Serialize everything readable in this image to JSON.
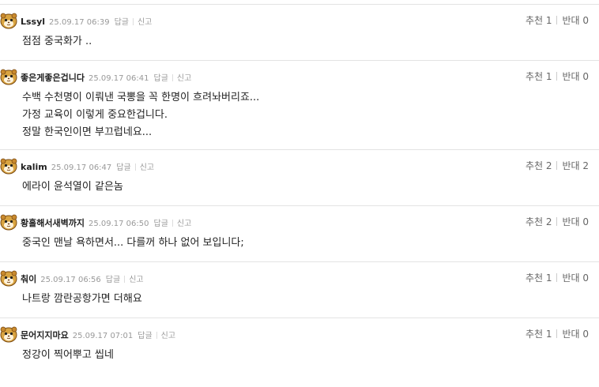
{
  "actions": {
    "reply": "답글",
    "report": "신고"
  },
  "comments": [
    {
      "nick": "Lssyl",
      "date": "25.09.17 06:39",
      "lines": [
        "점점 중국화가 .."
      ],
      "up_label": "추천 1",
      "down_label": "반대 0",
      "avatar_icon": "hamster-avatar-icon"
    },
    {
      "nick": "좋은게좋은겁니다",
      "date": "25.09.17 06:41",
      "lines": [
        "수백 수천명이 이뤄낸 국뽕을 꼭 한명이 흐려놔버리죠...",
        "가정 교육이 이렇게 중요한겁니다.",
        "정말 한국인이면 부끄럽네요..."
      ],
      "up_label": "추천 1",
      "down_label": "반대 0",
      "avatar_icon": "hamster-avatar-icon"
    },
    {
      "nick": "kalim",
      "date": "25.09.17 06:47",
      "lines": [
        "에라이 윤석열이 같은놈"
      ],
      "up_label": "추천 2",
      "down_label": "반대 2",
      "avatar_icon": "hamster-avatar-icon"
    },
    {
      "nick": "황홀해서새벽까지",
      "date": "25.09.17 06:50",
      "lines": [
        "중국인 맨날 욕하면서... 다를꺼 하나 없어 보입니다;"
      ],
      "up_label": "추천 2",
      "down_label": "반대 0",
      "avatar_icon": "hamster-avatar-icon"
    },
    {
      "nick": "춰이",
      "date": "25.09.17 06:56",
      "lines": [
        "나트랑 깜란공항가면 더해요"
      ],
      "up_label": "추천 1",
      "down_label": "반대 0",
      "avatar_icon": "hamster-avatar-icon"
    },
    {
      "nick": "문어지지마요",
      "date": "25.09.17 07:01",
      "lines": [
        "정강이 찍어뿌고 씹네"
      ],
      "up_label": "추천 1",
      "down_label": "반대 0",
      "avatar_icon": "hamster-avatar-icon"
    }
  ]
}
